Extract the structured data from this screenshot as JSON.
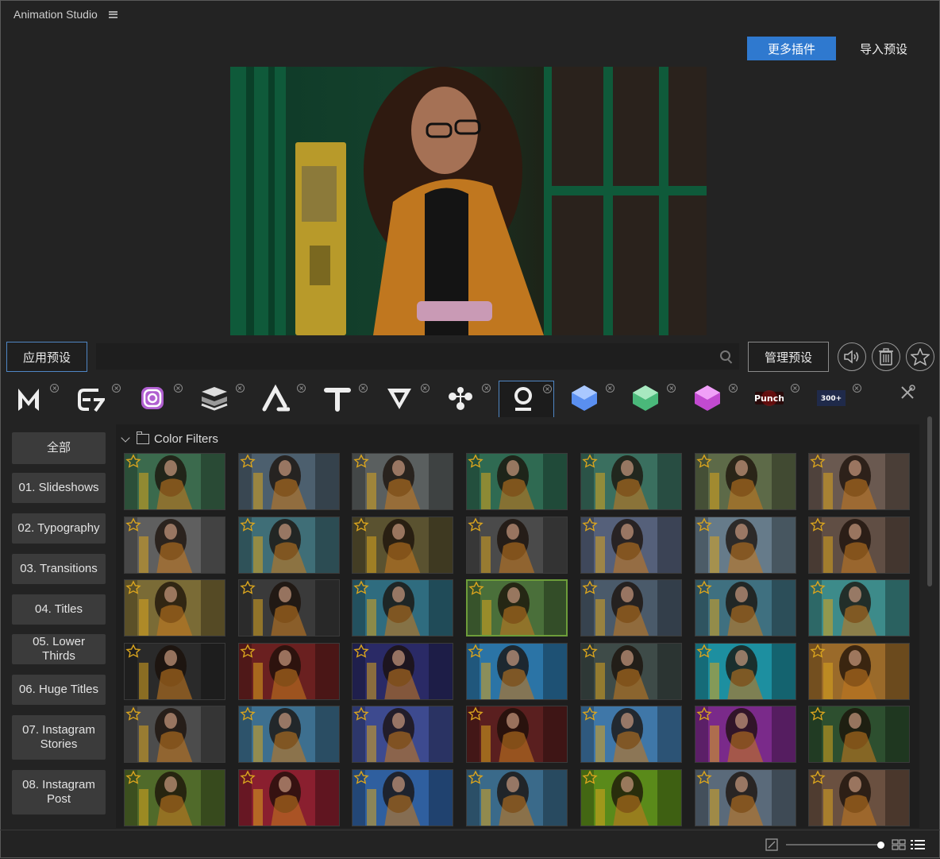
{
  "app": {
    "title": "Animation Studio"
  },
  "header": {
    "more_plugins": "更多插件",
    "import_presets": "导入预设"
  },
  "toolbar": {
    "apply_preset": "应用预设",
    "manage_presets": "管理预设",
    "search_value": "",
    "search_placeholder": ""
  },
  "plugins": [
    {
      "name": "m-plugin-icon"
    },
    {
      "name": "e7-plugin-icon"
    },
    {
      "name": "instagram-plugin-icon"
    },
    {
      "name": "layers-plugin-icon"
    },
    {
      "name": "a-plugin-icon"
    },
    {
      "name": "t-plugin-icon"
    },
    {
      "name": "v-plugin-icon"
    },
    {
      "name": "nodes-plugin-icon"
    },
    {
      "name": "o-plugin-icon",
      "selected": true
    },
    {
      "name": "blue-cube-plugin-icon"
    },
    {
      "name": "green-cube-plugin-icon"
    },
    {
      "name": "pink-cube-plugin-icon"
    },
    {
      "name": "punch-plugin-icon",
      "label": "Punch"
    },
    {
      "name": "transitions-plugin-icon",
      "label": "300+"
    }
  ],
  "categories": [
    {
      "label": "全部"
    },
    {
      "label": "01. Slideshows"
    },
    {
      "label": "02. Typography"
    },
    {
      "label": "03. Transitions"
    },
    {
      "label": "04. Titles"
    },
    {
      "label": "05. Lower Thirds"
    },
    {
      "label": "06. Huge Titles"
    },
    {
      "label": "07. Instagram Stories"
    },
    {
      "label": "08. Instagram Post"
    }
  ],
  "folder": {
    "label": "Color Filters"
  },
  "colors": {
    "accent": "#2f79cf",
    "selection_green": "#6d9d3a",
    "star": "#d9a41e"
  },
  "filters": [
    "#3b6a4d",
    "#4c5f6e",
    "#5a5f5f",
    "#2f6a52",
    "#3a6f5f",
    "#5d6a48",
    "#6a5950",
    "#5f5f5f",
    "#3f6e77",
    "#5a5230",
    "#4a4a4a",
    "#55607a",
    "#667b8a",
    "#604e44",
    "#7a6b36",
    "#3a3a3a",
    "#2f6c7f",
    "#4a6f3a",
    "#4a5a6a",
    "#3f7080",
    "#3d8b8a",
    "#2a2a2a",
    "#6a2020",
    "#2a2a66",
    "#2b74a6",
    "#3e4b48",
    "#1d8fa0",
    "#9a6a2a",
    "#4c4c4c",
    "#3d6f8f",
    "#3d4a8f",
    "#5a1f1f",
    "#3f77a8",
    "#7a2a8a",
    "#2d4f2f",
    "#506a2a",
    "#8a1f2f",
    "#2f5f9f",
    "#3a6a8a",
    "#5a8a1a",
    "#5a6a7a",
    "#6a5040"
  ],
  "selected_filter_index": 17
}
